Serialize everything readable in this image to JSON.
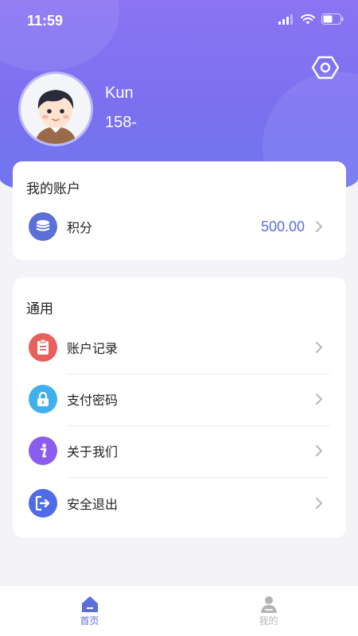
{
  "status_bar": {
    "time": "11:59"
  },
  "profile": {
    "name": "Kun",
    "phone": "158-"
  },
  "account_card": {
    "title": "我的账户",
    "points": {
      "label": "积分",
      "value": "500.00"
    }
  },
  "general_card": {
    "title": "通用",
    "items": [
      {
        "label": "账户记录",
        "icon": "record-icon"
      },
      {
        "label": "支付密码",
        "icon": "lock-icon"
      },
      {
        "label": "关于我们",
        "icon": "info-icon"
      },
      {
        "label": "安全退出",
        "icon": "logout-icon"
      }
    ]
  },
  "tabbar": {
    "home": {
      "label": "首页",
      "active": true
    },
    "mine": {
      "label": "我的",
      "active": false
    }
  },
  "colors": {
    "header_gradient": [
      "#8b74f3",
      "#6e78ee"
    ],
    "accent": "#5b6fd9",
    "record": "#e8605c",
    "lock": "#3fb0ec",
    "info": "#8a5cf0",
    "logout": "#4f6be8",
    "tab_inactive": "#b4b4b4"
  }
}
